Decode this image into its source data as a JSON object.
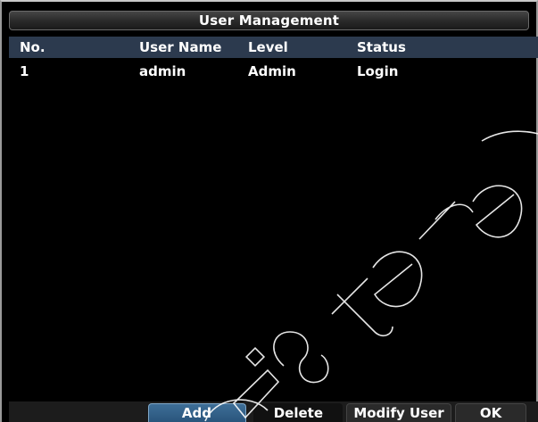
{
  "window": {
    "title": "User Management"
  },
  "table": {
    "columns": [
      "No.",
      "User Name",
      "Level",
      "Status"
    ],
    "rows": [
      {
        "no": "1",
        "user_name": "admin",
        "level": "Admin",
        "status": "Login"
      }
    ]
  },
  "buttons": {
    "add": "Add",
    "delete": "Delete",
    "modify_user": "Modify User",
    "ok": "OK"
  },
  "colors": {
    "header_bg": "#2c3a4e",
    "selected_button": "#29557c"
  }
}
